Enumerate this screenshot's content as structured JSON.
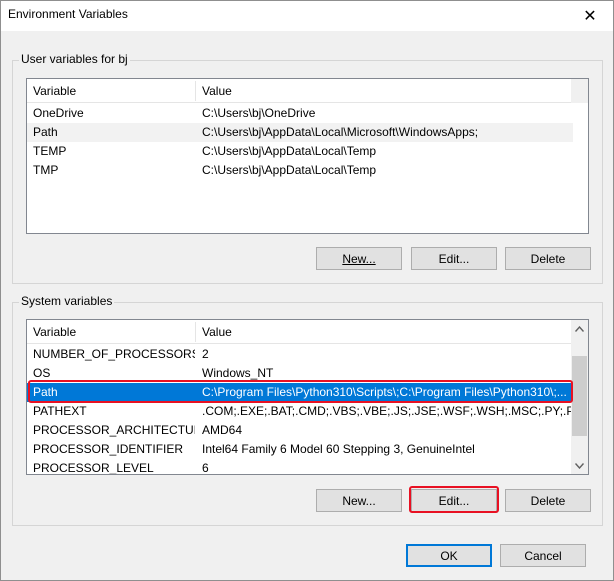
{
  "window": {
    "title": "Environment Variables",
    "close_glyph": "✕"
  },
  "user_group": {
    "legend": "User variables for bj",
    "columns": [
      "Variable",
      "Value"
    ],
    "rows": [
      {
        "variable": "OneDrive",
        "value": "C:\\Users\\bj\\OneDrive"
      },
      {
        "variable": "Path",
        "value": "C:\\Users\\bj\\AppData\\Local\\Microsoft\\WindowsApps;"
      },
      {
        "variable": "TEMP",
        "value": "C:\\Users\\bj\\AppData\\Local\\Temp"
      },
      {
        "variable": "TMP",
        "value": "C:\\Users\\bj\\AppData\\Local\\Temp"
      }
    ],
    "buttons": {
      "new": "New...",
      "edit": "Edit...",
      "delete": "Delete"
    }
  },
  "system_group": {
    "legend": "System variables",
    "columns": [
      "Variable",
      "Value"
    ],
    "rows": [
      {
        "variable": "NUMBER_OF_PROCESSORS",
        "value": "2"
      },
      {
        "variable": "OS",
        "value": "Windows_NT"
      },
      {
        "variable": "Path",
        "value": "C:\\Program Files\\Python310\\Scripts\\;C:\\Program Files\\Python310\\;..."
      },
      {
        "variable": "PATHEXT",
        "value": ".COM;.EXE;.BAT;.CMD;.VBS;.VBE;.JS;.JSE;.WSF;.WSH;.MSC;.PY;.PYW"
      },
      {
        "variable": "PROCESSOR_ARCHITECTURE",
        "value": "AMD64"
      },
      {
        "variable": "PROCESSOR_IDENTIFIER",
        "value": "Intel64 Family 6 Model 60 Stepping 3, GenuineIntel"
      },
      {
        "variable": "PROCESSOR_LEVEL",
        "value": "6"
      }
    ],
    "selected_variable": "Path",
    "buttons": {
      "new": "New...",
      "edit": "Edit...",
      "delete": "Delete"
    }
  },
  "footer": {
    "ok": "OK",
    "cancel": "Cancel"
  },
  "colors": {
    "selection": "#0078d7",
    "highlight": "#e81123"
  },
  "icons": {
    "close": "close-icon",
    "scroll_up": "chevron-up-icon",
    "scroll_down": "chevron-down-icon"
  }
}
